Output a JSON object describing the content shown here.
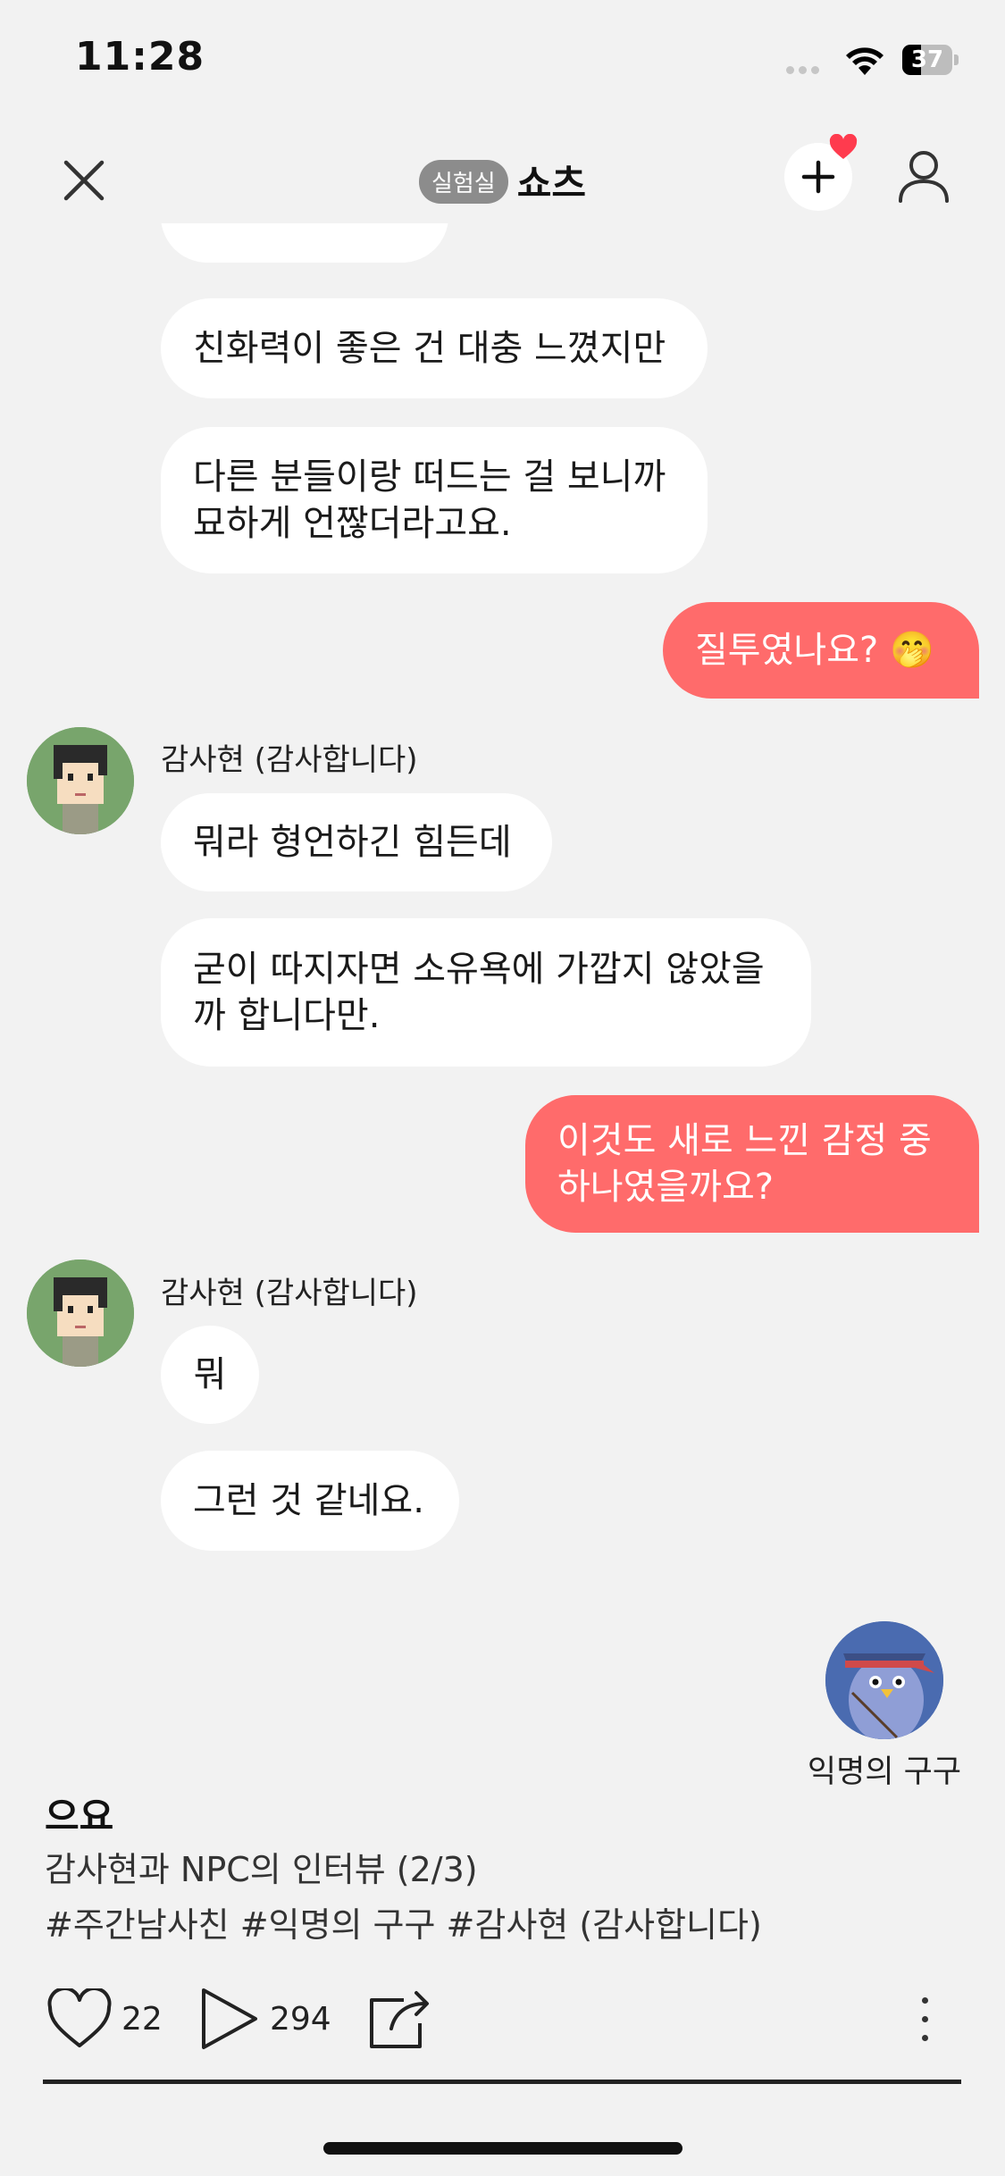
{
  "status_bar": {
    "time": "11:28",
    "battery_level": "37",
    "battery_percent": 37
  },
  "nav": {
    "badge": "실험실",
    "title": "쇼츠"
  },
  "messages": [
    {
      "type": "received",
      "text": "친화력이 좋은 건 대충 느꼈지만"
    },
    {
      "type": "received",
      "text": "다른 분들이랑 떠드는 걸 보니까 묘하게 언짢더라고요."
    },
    {
      "type": "sent",
      "text": "질투였나요? 🤭"
    },
    {
      "type": "received",
      "sender": "감사현 (감사합니다)",
      "text": "뭐라 형언하긴 힘든데"
    },
    {
      "type": "received",
      "text": "굳이 따지자면 소유욕에 가깝지 않았을까 합니다만."
    },
    {
      "type": "sent",
      "text": "이것도 새로 느낀 감정 중 하나였을까요?"
    },
    {
      "type": "received",
      "sender": "감사현 (감사합니다)",
      "text": "뭐"
    },
    {
      "type": "received",
      "text": "그런 것 같네요."
    }
  ],
  "partial_message": "...",
  "user": {
    "name": "익명의 구구"
  },
  "post": {
    "title": "으요",
    "description": "감사현과 NPC의 인터뷰 (2/3)",
    "tags": "#주간남사친 #익명의 구구 #감사현 (감사합니다)"
  },
  "actions": {
    "likes": "22",
    "plays": "294"
  },
  "playback_progress": 1.0,
  "colors": {
    "sent_bubble": "#ff6b6b",
    "background": "#f2f2f2",
    "badge": "#8c8c8c",
    "notification": "#ff3b4e"
  }
}
